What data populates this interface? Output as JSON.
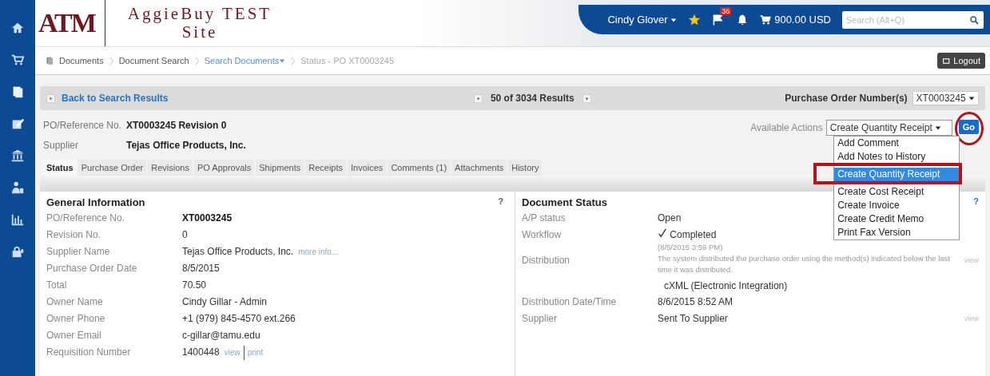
{
  "header": {
    "logo": "ATM",
    "site_title": [
      "AggieBuy TEST",
      "Site"
    ],
    "user": "Cindy Glover",
    "notification_count": "36",
    "cart_total": "900.00 USD",
    "search": {
      "placeholder": "Search (Alt+Q)"
    }
  },
  "breadcrumbs": [
    {
      "label": "Documents",
      "kind": "plain"
    },
    {
      "label": "Document Search",
      "kind": "plain"
    },
    {
      "label": "Search Documents",
      "kind": "menu"
    },
    {
      "label": "Status - PO XT0003245",
      "kind": "current"
    }
  ],
  "logout": "Logout",
  "nav": {
    "back": "Back to Search Results",
    "results": "50 of 3034 Results",
    "po_label": "Purchase Order Number(s)",
    "po_value": "XT0003245"
  },
  "summary": [
    {
      "label": "PO/Reference No.",
      "value": "XT0003245 Revision 0"
    },
    {
      "label": "Supplier",
      "value": "Tejas Office Products, Inc."
    }
  ],
  "actions": {
    "label": "Available Actions",
    "value": "Create Quantity Receipt",
    "go": "Go",
    "options": [
      {
        "label": "Add Comment",
        "selected": false
      },
      {
        "label": "Add Notes to History",
        "selected": false
      },
      {
        "label": "Create Quantity Receipt",
        "selected": true
      },
      {
        "label": "Create Cost Receipt",
        "selected": false
      },
      {
        "label": "Create Invoice",
        "selected": false
      },
      {
        "label": "Create Credit Memo",
        "selected": false
      },
      {
        "label": "Print Fax Version",
        "selected": false
      }
    ]
  },
  "tabs": [
    {
      "label": "Status",
      "selected": true
    },
    {
      "label": "Purchase Order",
      "selected": false
    },
    {
      "label": "Revisions",
      "selected": false
    },
    {
      "label": "PO Approvals",
      "selected": false
    },
    {
      "label": "Shipments",
      "selected": false
    },
    {
      "label": "Receipts",
      "selected": false
    },
    {
      "label": "Invoices",
      "selected": false
    },
    {
      "label": "Comments (1)",
      "selected": false
    },
    {
      "label": "Attachments",
      "selected": false
    },
    {
      "label": "History",
      "selected": false
    }
  ],
  "general_information": {
    "title": "General Information",
    "help": "?",
    "rows": [
      {
        "label": "PO/Reference No.",
        "value": "XT0003245",
        "bold": true,
        "links": []
      },
      {
        "label": "Revision No.",
        "value": "0",
        "bold": false,
        "links": []
      },
      {
        "label": "Supplier Name",
        "value": "Tejas Office Products, Inc.",
        "bold": false,
        "links": [
          "more info..."
        ]
      },
      {
        "label": "Purchase Order Date",
        "value": "8/5/2015",
        "bold": false,
        "links": []
      },
      {
        "label": "Total",
        "value": "70.50",
        "bold": false,
        "links": []
      },
      {
        "label": "Owner Name",
        "value": "Cindy Gillar - Admin",
        "bold": false,
        "links": []
      },
      {
        "label": "Owner Phone",
        "value": "+1 (979) 845-4570 ext.266",
        "bold": false,
        "links": []
      },
      {
        "label": "Owner Email",
        "value": "c-gillar@tamu.edu",
        "bold": false,
        "links": []
      },
      {
        "label": "Requisition Number",
        "value": "1400448",
        "bold": false,
        "links": [
          "view",
          "print"
        ]
      }
    ]
  },
  "document_status": {
    "title": "Document Status",
    "help": "?",
    "rows": [
      {
        "label": "A/P status",
        "lines": [
          "Open"
        ],
        "kind": "plain",
        "side_link": ""
      },
      {
        "label": "Workflow",
        "lines": [
          "Completed",
          "(8/5/2015 3:59 PM)"
        ],
        "kind": "check",
        "side_link": ""
      },
      {
        "label": "Distribution",
        "lines": [
          "The system distributed the purchase order using the method(s) indicated below the last time it was distributed.",
          "cXML (Electronic Integration)"
        ],
        "kind": "note",
        "side_link": "view"
      },
      {
        "label": "Distribution Date/Time",
        "lines": [
          "8/6/2015 8:52 AM"
        ],
        "kind": "plain",
        "side_link": ""
      },
      {
        "label": "Supplier",
        "lines": [
          "Sent To Supplier"
        ],
        "kind": "plain",
        "side_link": "view"
      }
    ]
  }
}
